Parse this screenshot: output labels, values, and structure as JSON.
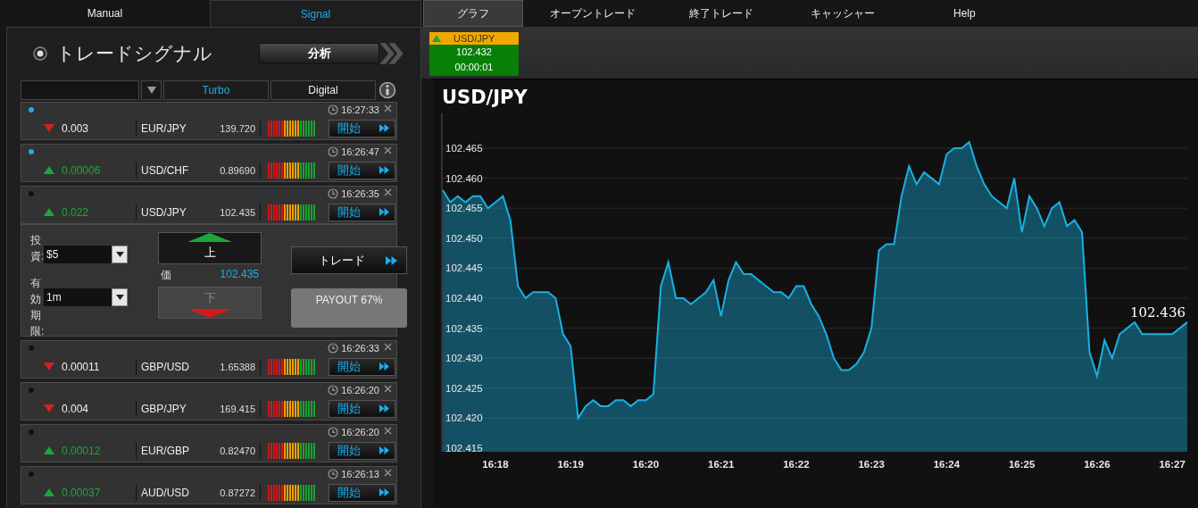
{
  "top_tabs": [
    {
      "label": "Manual",
      "selected": false
    },
    {
      "label": "Signal",
      "selected": true
    }
  ],
  "signal_panel": {
    "title": "トレードシグナル",
    "analysis_button": "分析",
    "filter_tabs": [
      {
        "label": "Turbo",
        "selected": true
      },
      {
        "label": "Digital",
        "selected": false
      }
    ],
    "signals": [
      {
        "highlighted": true,
        "kind": "down",
        "change": "0.003",
        "pair": "EUR/JPY",
        "price": "139.720",
        "time": "16:27:33",
        "action": "開始",
        "expanded": false
      },
      {
        "highlighted": true,
        "kind": "up",
        "change": "0.00006",
        "pair": "USD/CHF",
        "price": "0.89690",
        "time": "16:26:47",
        "action": "開始",
        "expanded": false
      },
      {
        "highlighted": false,
        "kind": "up",
        "change": "0.022",
        "pair": "USD/JPY",
        "price": "102.435",
        "time": "16:26:35",
        "action": "開始",
        "expanded": true
      },
      {
        "highlighted": false,
        "kind": "down",
        "change": "0.00011",
        "pair": "GBP/USD",
        "price": "1.65388",
        "time": "16:26:33",
        "action": "開始",
        "expanded": false
      },
      {
        "highlighted": false,
        "kind": "down",
        "change": "0.004",
        "pair": "GBP/JPY",
        "price": "169.415",
        "time": "16:26:20",
        "action": "開始",
        "expanded": false
      },
      {
        "highlighted": false,
        "kind": "up",
        "change": "0.00012",
        "pair": "EUR/GBP",
        "price": "0.82470",
        "time": "16:26:20",
        "action": "開始",
        "expanded": false
      },
      {
        "highlighted": false,
        "kind": "up",
        "change": "0.00037",
        "pair": "AUD/USD",
        "price": "0.87272",
        "time": "16:26:13",
        "action": "開始",
        "expanded": false
      }
    ],
    "trade_form": {
      "investment_label": "投資:",
      "investment_value": "$5",
      "expiry_label": "有効期限:",
      "expiry_value": "1m",
      "up_button": "上",
      "price_label": "価",
      "price": "102.435",
      "down_button": "下",
      "down_disabled": true,
      "trade_button": "トレード",
      "payout": "PAYOUT 67%"
    }
  },
  "nav_tabs": [
    {
      "label": "グラフ",
      "selected": true
    },
    {
      "label": "オープントレード",
      "selected": false
    },
    {
      "label": "終了トレード",
      "selected": false
    },
    {
      "label": "キャッシャー",
      "selected": false
    },
    {
      "label": "Help",
      "selected": false
    }
  ],
  "ticker": {
    "pair": "USD/JPY",
    "kind": "up",
    "price": "102.432",
    "timer": "00:00:01"
  },
  "chart": {
    "chart_data": {
      "type": "area",
      "categories": [
        null,
        null,
        null,
        null,
        null,
        null,
        null,
        "16:18",
        null,
        null,
        null,
        null,
        null,
        null,
        null,
        null,
        null,
        "16:19",
        null,
        null,
        null,
        null,
        null,
        null,
        null,
        null,
        null,
        "16:20",
        null,
        null,
        null,
        null,
        null,
        null,
        null,
        null,
        null,
        "16:21",
        null,
        null,
        null,
        null,
        null,
        null,
        null,
        null,
        null,
        "16:22",
        null,
        null,
        null,
        null,
        null,
        null,
        null,
        null,
        null,
        "16:23",
        null,
        null,
        null,
        null,
        null,
        null,
        null,
        null,
        null,
        "16:24",
        null,
        null,
        null,
        null,
        null,
        null,
        null,
        null,
        null,
        "16:25",
        null,
        null,
        null,
        null,
        null,
        null,
        null,
        null,
        null,
        "16:26",
        null,
        null,
        null,
        null,
        null,
        null,
        null,
        null,
        null,
        "16:27",
        null,
        null
      ],
      "series": [
        {
          "name": "USD/JPY",
          "color": "#1ab0e0",
          "values": [
            102.458,
            102.456,
            102.457,
            102.456,
            102.457,
            102.457,
            102.455,
            102.456,
            102.457,
            102.453,
            102.442,
            102.44,
            102.441,
            102.441,
            102.441,
            102.44,
            102.434,
            102.432,
            102.42,
            102.422,
            102.423,
            102.422,
            102.422,
            102.423,
            102.423,
            102.422,
            102.423,
            102.423,
            102.424,
            102.442,
            102.446,
            102.44,
            102.44,
            102.439,
            102.44,
            102.441,
            102.443,
            102.437,
            102.443,
            102.446,
            102.444,
            102.444,
            102.443,
            102.442,
            102.441,
            102.441,
            102.44,
            102.442,
            102.442,
            102.439,
            102.437,
            102.434,
            102.43,
            102.428,
            102.428,
            102.429,
            102.431,
            102.435,
            102.448,
            102.449,
            102.449,
            102.457,
            102.462,
            102.459,
            102.461,
            102.46,
            102.459,
            102.464,
            102.465,
            102.465,
            102.466,
            102.462,
            102.459,
            102.457,
            102.456,
            102.455,
            102.46,
            102.451,
            102.457,
            102.455,
            102.452,
            102.455,
            102.456,
            102.452,
            102.453,
            102.451,
            102.431,
            102.427,
            102.433,
            102.43,
            102.434,
            102.435,
            102.436,
            102.434,
            102.434,
            102.434,
            102.434,
            102.434,
            102.435,
            102.436
          ]
        }
      ],
      "grid": true,
      "ylim": [
        102.4144,
        102.4708
      ],
      "yticks": [
        {
          "value": 102.415,
          "label": "102.415"
        },
        {
          "value": 102.42,
          "label": "102.420"
        },
        {
          "value": 102.425,
          "label": "102.425"
        },
        {
          "value": 102.43,
          "label": "102.430"
        },
        {
          "value": 102.435,
          "label": "102.435"
        },
        {
          "value": 102.44,
          "label": "102.440"
        },
        {
          "value": 102.445,
          "label": "102.445"
        },
        {
          "value": 102.45,
          "label": "102.450"
        },
        {
          "value": 102.455,
          "label": "102.455"
        },
        {
          "value": 102.46,
          "label": "102.460"
        },
        {
          "value": 102.465,
          "label": "102.465"
        }
      ],
      "annotations": [
        {
          "text": "102.436"
        }
      ]
    }
  }
}
